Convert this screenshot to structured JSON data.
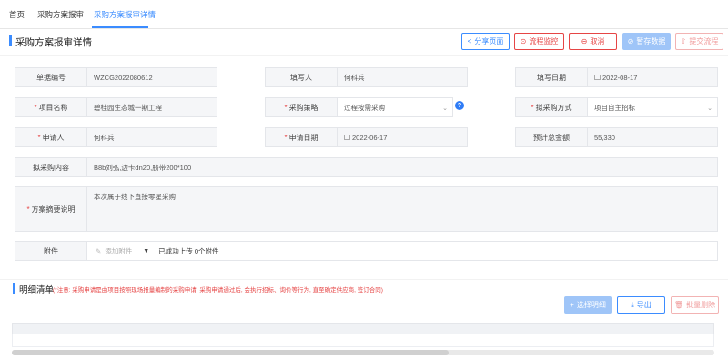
{
  "tabs": [
    {
      "label": "首页"
    },
    {
      "label": "采购方案报审"
    },
    {
      "label": "采购方案报审详情"
    }
  ],
  "header": {
    "title": "采购方案报审详情",
    "buttons": {
      "share": "分享页面",
      "flow_monitor": "流程监控",
      "cancel": "取消",
      "save_temp": "暂存数据",
      "submit_flow": "提交流程"
    }
  },
  "form": {
    "doc_no_label": "单据编号",
    "doc_no": "WZCG2022080612",
    "filler_label": "填写人",
    "filler": "何科兵",
    "fill_date_label": "填写日期",
    "fill_date": "2022-08-17",
    "project_name_label": "项目名称",
    "project_name": "碧桂园生态城一期工程",
    "strategy_label": "采购策略",
    "strategy": "过程按需采购",
    "method_label": "拟采购方式",
    "method": "项目自主招标",
    "applicant_label": "申请人",
    "applicant": "何科兵",
    "apply_date_label": "申请日期",
    "apply_date": "2022-06-17",
    "total_label": "预计总金额",
    "total": "55,330",
    "content_label": "拟采购内容",
    "content": "B8b刘弘,边卡dn20,脐带200*100",
    "summary_label": "方案摘要说明",
    "summary": "本次属于线下直接零星采购",
    "attachment_label": "附件",
    "attachment_add": "添加附件",
    "attachment_status": "已成功上传 0个附件"
  },
  "detail": {
    "title": "明细清单",
    "note": "(*注意: 采购申请是由项目按照现场报量编制的采购申请, 采购申请通过后, 会执行招标、询价等行为, 直至确定供应商, 签订合同)",
    "buttons": {
      "select_detail": "选择明细",
      "export": "导出",
      "batch_delete": "批量删除"
    }
  },
  "colors": {
    "accent": "#3b8cff",
    "danger": "#e64545",
    "disabled": "#9fc5f8"
  }
}
